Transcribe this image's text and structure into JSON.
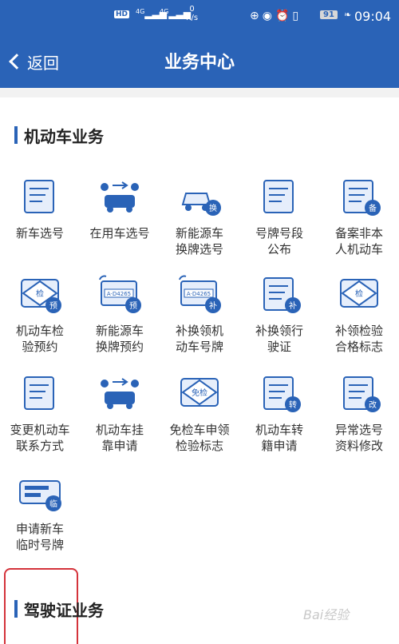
{
  "status_bar": {
    "hd": "HD",
    "signal_1": "4G",
    "signal_2": "4G",
    "speed_value": "0",
    "speed_unit": "K/s",
    "battery": "91",
    "time": "09:04"
  },
  "header": {
    "back_label": "返回",
    "title": "业务中心"
  },
  "sections": [
    {
      "title": "机动车业务",
      "items": [
        {
          "label": "新车选号",
          "badge": ""
        },
        {
          "label": "在用车选号",
          "badge": ""
        },
        {
          "label": "新能源车\n换牌选号",
          "badge": "换"
        },
        {
          "label": "号牌号段\n公布",
          "badge": ""
        },
        {
          "label": "备案非本\n人机动车",
          "badge": "备"
        },
        {
          "label": "机动车检\n验预约",
          "badge": "预",
          "tag": "检"
        },
        {
          "label": "新能源车\n换牌预约",
          "badge": "预",
          "plate": "A·D4265"
        },
        {
          "label": "补换领机\n动车号牌",
          "badge": "补",
          "plate": "A·D4265"
        },
        {
          "label": "补换领行\n驶证",
          "badge": "补"
        },
        {
          "label": "补领检验\n合格标志",
          "badge": "",
          "tag": "检"
        },
        {
          "label": "变更机动车\n联系方式",
          "badge": ""
        },
        {
          "label": "机动车挂\n靠申请",
          "badge": ""
        },
        {
          "label": "免检车申领\n检验标志",
          "badge": "",
          "tag": "免检"
        },
        {
          "label": "机动车转\n籍申请",
          "badge": "转"
        },
        {
          "label": "异常选号\n资料修改",
          "badge": "改"
        },
        {
          "label": "申请新车\n临时号牌",
          "badge": "临"
        }
      ]
    },
    {
      "title": "驾驶证业务",
      "items": []
    }
  ],
  "watermark": "Bai经验",
  "colors": {
    "header_blue": "#2a63b7",
    "icon_blue": "#2a63b7",
    "icon_light": "#e6eefb",
    "highlight_red": "#d4333b"
  }
}
